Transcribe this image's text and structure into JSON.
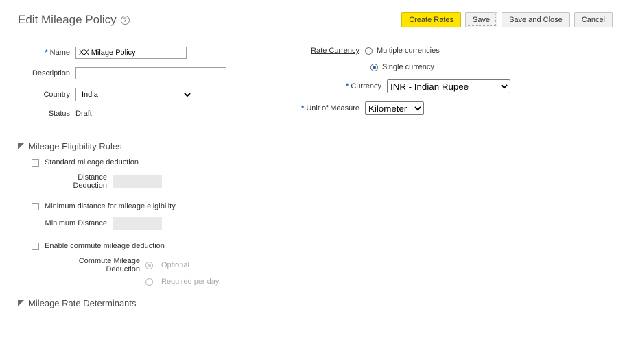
{
  "header": {
    "title": "Edit Mileage Policy",
    "help_tooltip": "?"
  },
  "buttons": {
    "create_rates": "Create Rates",
    "save": "Save",
    "save_and_close_prefix": "S",
    "save_and_close_rest": "ave and Close",
    "cancel_prefix": "C",
    "cancel_rest": "ancel"
  },
  "left": {
    "name_label": "Name",
    "name_value": "XX Milage Policy",
    "description_label": "Description",
    "description_value": "",
    "country_label": "Country",
    "country_value": "India",
    "country_options": [
      "India"
    ],
    "status_label": "Status",
    "status_value": "Draft"
  },
  "right": {
    "rate_currency_label": "Rate Currency",
    "rc_multiple": "Multiple currencies",
    "rc_single": "Single currency",
    "rc_selected": "single",
    "currency_label": "Currency",
    "currency_value": "INR - Indian Rupee",
    "currency_options": [
      "INR - Indian Rupee"
    ],
    "uom_label": "Unit of Measure",
    "uom_value": "Kilometer",
    "uom_options": [
      "Kilometer"
    ]
  },
  "sections": {
    "eligibility_title": "Mileage Eligibility Rules",
    "rate_determinants_title": "Mileage Rate Determinants"
  },
  "eligibility": {
    "standard_deduction_label": "Standard mileage deduction",
    "distance_deduction_label": "Distance Deduction",
    "min_distance_rule_label": "Minimum distance for mileage eligibility",
    "min_distance_label": "Minimum Distance",
    "commute_rule_label": "Enable commute mileage deduction",
    "commute_deduction_label": "Commute Mileage Deduction",
    "commute_optional": "Optional",
    "commute_required": "Required per day"
  }
}
